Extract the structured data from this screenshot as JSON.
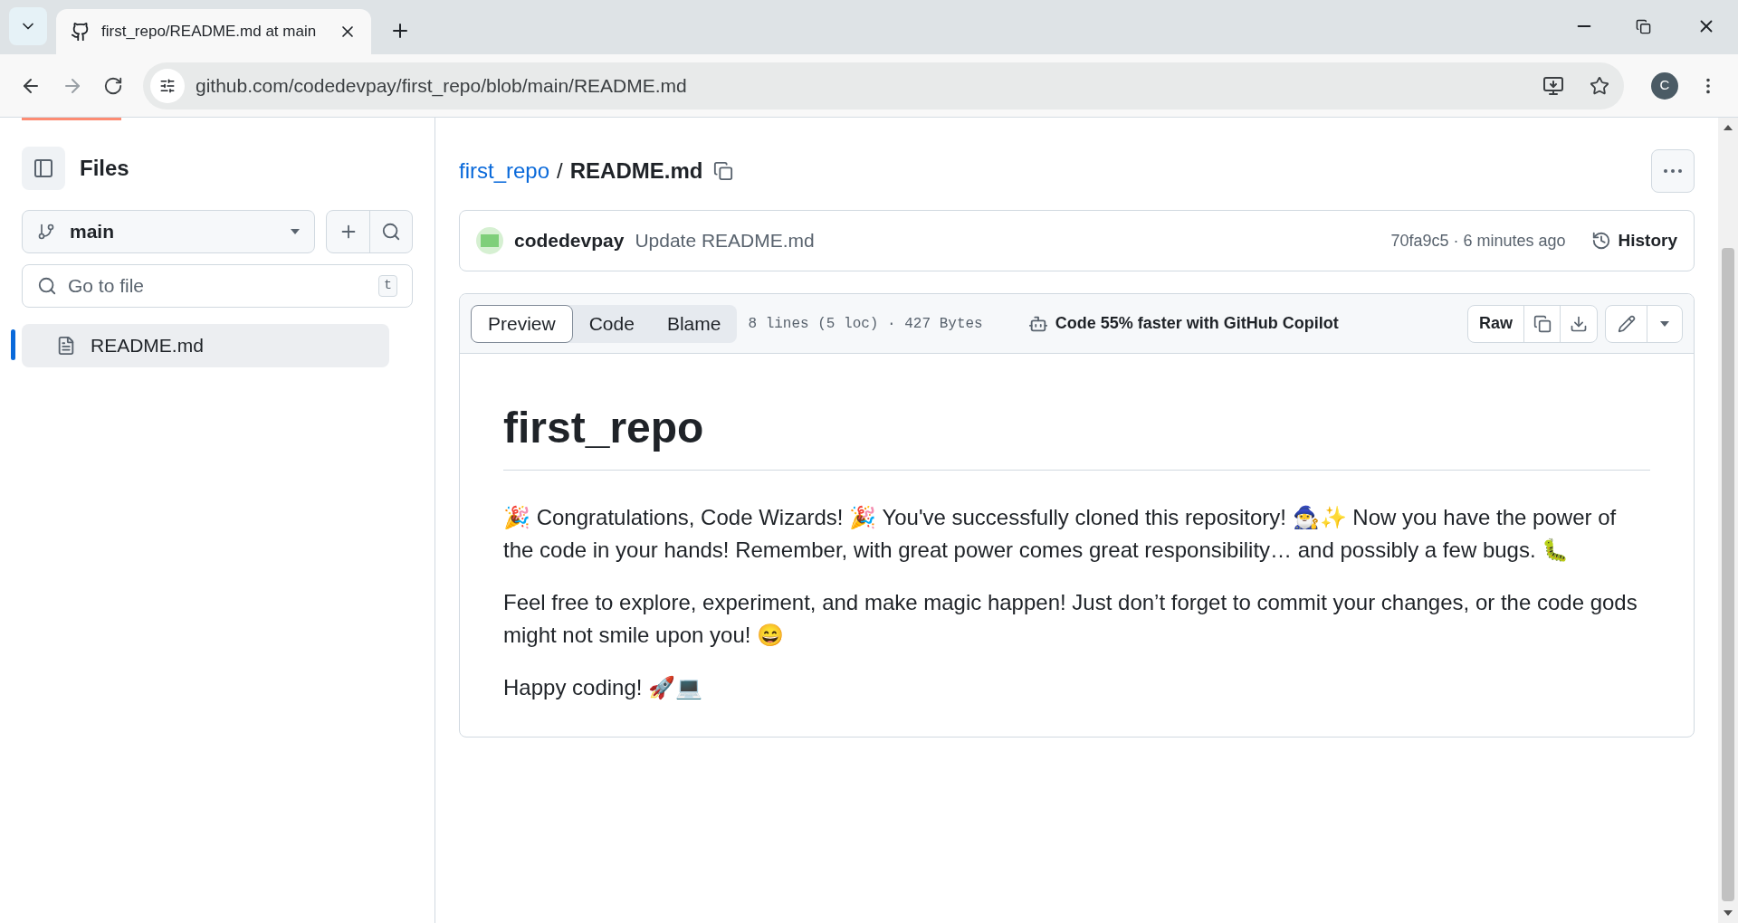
{
  "browser": {
    "tab_title": "first_repo/README.md at main",
    "url": "github.com/codedevpay/first_repo/blob/main/README.md",
    "profile_initial": "C"
  },
  "sidebar": {
    "title": "Files",
    "branch": "main",
    "search_placeholder": "Go to file",
    "shortcut": "t",
    "files": [
      {
        "name": "README.md",
        "selected": true
      }
    ]
  },
  "breadcrumb": {
    "repo": "first_repo",
    "separator": "/",
    "file": "README.md"
  },
  "commit": {
    "author": "codedevpay",
    "message": "Update README.md",
    "sha_time": "70fa9c5 · 6 minutes ago",
    "history": "History"
  },
  "toolbar": {
    "tabs": [
      {
        "label": "Preview",
        "selected": true
      },
      {
        "label": "Code",
        "selected": false
      },
      {
        "label": "Blame",
        "selected": false
      }
    ],
    "info": "8 lines (5 loc) · 427 Bytes",
    "copilot": "Code 55% faster with GitHub Copilot",
    "raw": "Raw"
  },
  "readme": {
    "heading": "first_repo",
    "paragraphs": [
      "🎉 Congratulations, Code Wizards! 🎉 You've successfully cloned this repository! 🧙‍♂️✨ Now you have the power of the code in your hands! Remember, with great power comes great responsibility… and possibly a few bugs. 🐛",
      "Feel free to explore, experiment, and make magic happen! Just don’t forget to commit your changes, or the code gods might not smile upon you! 😄",
      "Happy coding! 🚀💻"
    ]
  }
}
